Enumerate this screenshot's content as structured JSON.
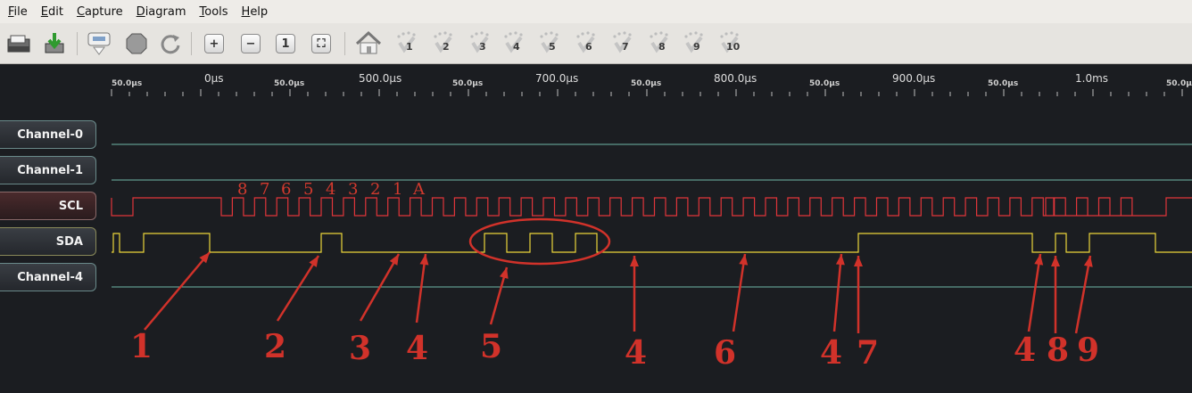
{
  "menu": [
    "File",
    "Edit",
    "Capture",
    "Diagram",
    "Tools",
    "Help"
  ],
  "toolbar": {
    "buttons": [
      {
        "name": "open-icon"
      },
      {
        "name": "save-icon"
      },
      {
        "name": "capture-icon"
      },
      {
        "name": "stop-icon"
      },
      {
        "name": "reload-icon"
      },
      {
        "name": "zoom-in-icon",
        "glyph": "+"
      },
      {
        "name": "zoom-out-icon",
        "glyph": "−"
      },
      {
        "name": "zoom-original-icon",
        "glyph": "1"
      },
      {
        "name": "zoom-fit-icon",
        "glyph": "⛶"
      },
      {
        "name": "home-icon"
      }
    ],
    "bookmarks": [
      "1",
      "2",
      "3",
      "4",
      "5",
      "6",
      "7",
      "8",
      "9",
      "10"
    ]
  },
  "timeline": {
    "major": [
      "0µs",
      "500.0µs",
      "700.0µs",
      "800.0µs",
      "900.0µs",
      "1.0ms"
    ],
    "minor": [
      "50.0µs",
      "50.0µs",
      "50.0µs",
      "50.0µs",
      "50.0µs",
      "50.0µs",
      "50.0µs"
    ]
  },
  "channels": [
    "Channel-0",
    "Channel-1",
    "SCL",
    "SDA",
    "Channel-4"
  ],
  "bit_labels": [
    "8",
    "7",
    "6",
    "5",
    "4",
    "3",
    "2",
    "1",
    "A"
  ],
  "annotations": [
    "1",
    "2",
    "3",
    "4",
    "5",
    "4",
    "6",
    "4",
    "7",
    "4",
    "8",
    "9"
  ],
  "colors": {
    "scl": "#e0353a",
    "sda": "#ecd63a",
    "idle": "#6fb8a8",
    "annotation": "#d1322a"
  }
}
